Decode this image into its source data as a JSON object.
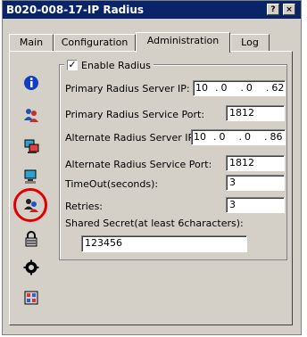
{
  "window": {
    "title": "B020-008-17-IP Radius",
    "help_button": "?",
    "close_button": "×"
  },
  "tabs": [
    {
      "label": "Main"
    },
    {
      "label": "Configuration"
    },
    {
      "label": "Administration"
    },
    {
      "label": "Log"
    }
  ],
  "sidebar": {
    "icons": [
      "info-icon",
      "users-icon",
      "computer-icon",
      "computer-icon",
      "radius-user-icon",
      "lock-icon",
      "gear-icon",
      "firmware-icon"
    ],
    "highlighted": "radius-user-icon"
  },
  "radius": {
    "enable_label": "Enable Radius",
    "enabled": true,
    "primary_ip_label": "Primary Radius Server IP:",
    "primary_ip": [
      "10",
      "0",
      "0",
      "62"
    ],
    "primary_port_label": "Primary Radius Service Port:",
    "primary_port": "1812",
    "alternate_ip_label": "Alternate Radius Server IP:",
    "alternate_ip": [
      "10",
      "0",
      "0",
      "86"
    ],
    "alternate_port_label": "Alternate Radius Service Port:",
    "alternate_port": "1812",
    "timeout_label": "TimeOut(seconds):",
    "timeout": "3",
    "retries_label": "Retries:",
    "retries": "3",
    "secret_label": "Shared Secret(at least 6characters):",
    "secret": "123456"
  },
  "colors": {
    "titlebar": "#0a246a",
    "face": "#d4d0c8",
    "highlight_circle": "#e00000"
  }
}
